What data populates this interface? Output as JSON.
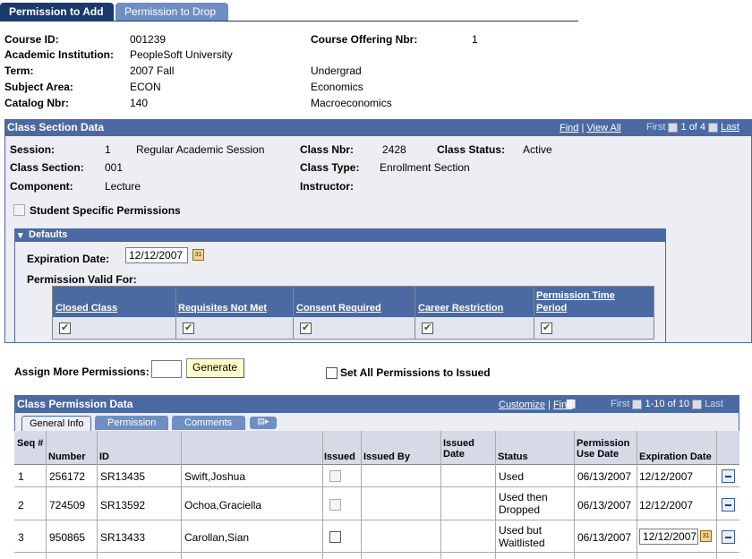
{
  "tabs": [
    {
      "label": "Permission to Add"
    },
    {
      "label": "Permission to Drop"
    }
  ],
  "course": {
    "course_id_label": "Course ID:",
    "course_id": "001239",
    "offering_label": "Course Offering Nbr:",
    "offering": "1",
    "institution_label": "Academic Institution:",
    "institution": "PeopleSoft University",
    "term_label": "Term:",
    "term": "2007 Fall",
    "career": "Undergrad",
    "subject_label": "Subject Area:",
    "subject": "ECON",
    "subject_desc": "Economics",
    "catalog_label": "Catalog Nbr:",
    "catalog": "140",
    "catalog_desc": "Macroeconomics"
  },
  "class_section": {
    "title": "Class Section Data",
    "find": "Find",
    "view_all": "View All",
    "first": "First",
    "range": "1 of 4",
    "last": "Last",
    "session_label": "Session:",
    "session_num": "1",
    "session_desc": "Regular Academic Session",
    "class_nbr_label": "Class Nbr:",
    "class_nbr": "2428",
    "status_label": "Class Status:",
    "status": "Active",
    "section_label": "Class Section:",
    "section": "001",
    "type_label": "Class Type:",
    "type": "Enrollment Section",
    "component_label": "Component:",
    "component": "Lecture",
    "instructor_label": "Instructor:",
    "student_specific": "Student Specific Permissions"
  },
  "defaults": {
    "title": "Defaults",
    "expiration_label": "Expiration Date:",
    "expiration": "12/12/2007",
    "valid_for_label": "Permission Valid For:",
    "columns": [
      "Closed Class",
      "Requisites Not Met",
      "Consent Required",
      "Career Restriction",
      "Permission Time Period"
    ]
  },
  "assign": {
    "label": "Assign More Permissions:",
    "value": "",
    "generate": "Generate",
    "set_all": "Set All Permissions to Issued"
  },
  "class_perm": {
    "title": "Class Permission Data",
    "customize": "Customize",
    "find": "Find",
    "first": "First",
    "range": "1-10 of 10",
    "last": "Last",
    "subtabs": [
      "General Info",
      "Permission",
      "Comments"
    ],
    "headers": {
      "seq": "Seq #",
      "number": "Number",
      "id": "ID",
      "issued": "Issued",
      "issued_by": "Issued By",
      "issued_date": "Issued Date",
      "status": "Status",
      "use_date": "Permission Use Date",
      "exp_date": "Expiration Date"
    },
    "rows": [
      {
        "seq": "1",
        "number": "256172",
        "id": "SR13435",
        "name": "Swift,Joshua",
        "status": "Used",
        "use_date": "06/13/2007",
        "exp_date": "12/12/2007"
      },
      {
        "seq": "2",
        "number": "724509",
        "id": "SR13592",
        "name": "Ochoa,Graciella",
        "status": "Used then Dropped",
        "use_date": "06/13/2007",
        "exp_date": "12/12/2007"
      },
      {
        "seq": "3",
        "number": "950865",
        "id": "SR13433",
        "name": "Carollan,Sian",
        "status": "Used but Waitlisted",
        "use_date": "06/13/2007",
        "exp_date": "12/12/2007"
      }
    ]
  }
}
